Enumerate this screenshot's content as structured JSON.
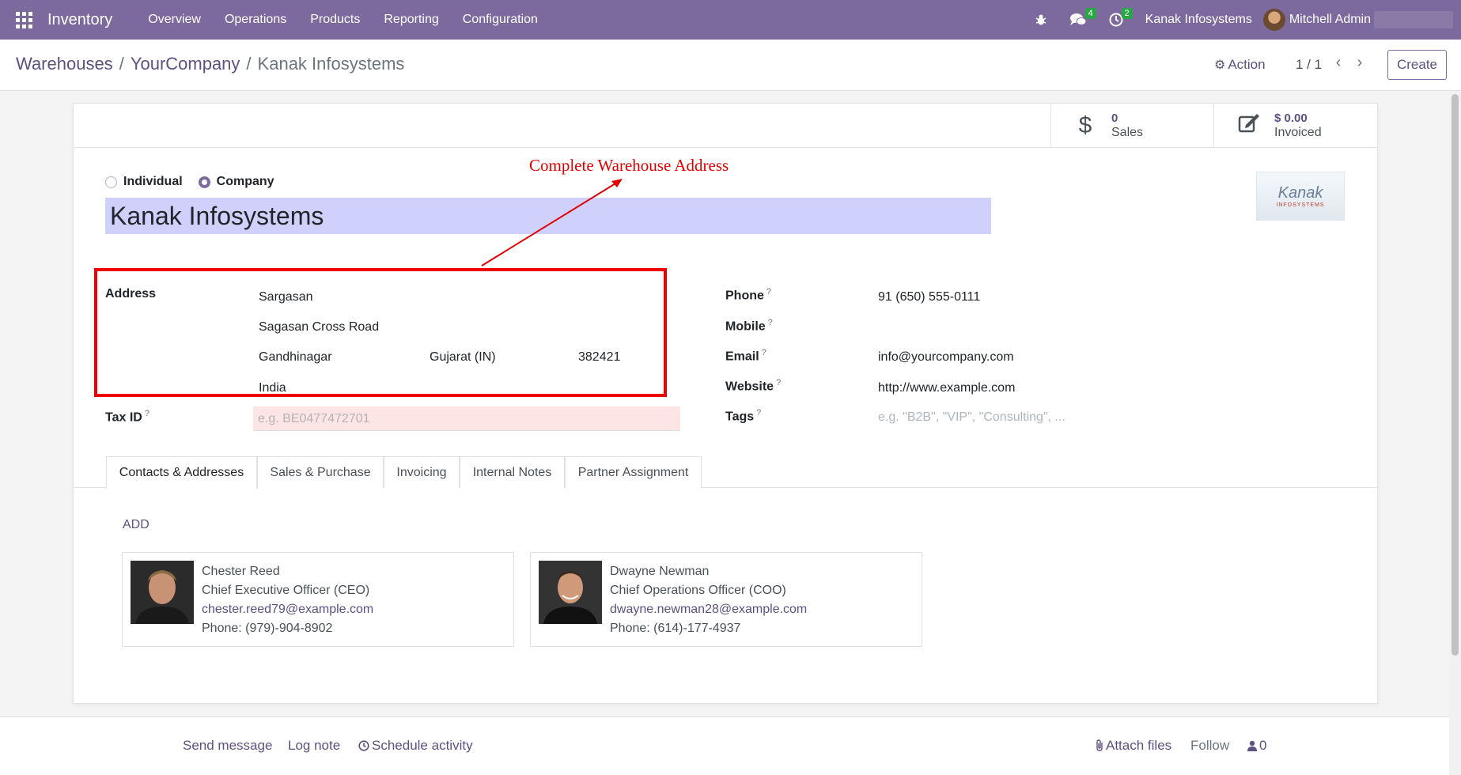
{
  "navbar": {
    "app_name": "Inventory",
    "menu": [
      "Overview",
      "Operations",
      "Products",
      "Reporting",
      "Configuration"
    ],
    "messages_badge": "4",
    "activities_badge": "2",
    "company": "Kanak Infosystems",
    "user": "Mitchell Admin",
    "accent_color": "#7c6a9e"
  },
  "breadcrumb": {
    "items": [
      "Warehouses",
      "YourCompany"
    ],
    "current": "Kanak Infosystems"
  },
  "control": {
    "action_label": "Action",
    "pager": "1 / 1",
    "create_label": "Create"
  },
  "stat_buttons": {
    "sales": {
      "value": "0",
      "label": "Sales",
      "icon": "dollar-icon"
    },
    "invoiced": {
      "value": "$ 0.00",
      "label": "Invoiced",
      "icon": "edit-icon"
    }
  },
  "company_type": {
    "individual": "Individual",
    "company": "Company",
    "selected": "company"
  },
  "partner_name": "Kanak Infosystems",
  "logo": {
    "text": "Kanak",
    "sub": "INFOSYSTEMS"
  },
  "annotation": "Complete Warehouse Address",
  "address": {
    "label": "Address",
    "street": "Sargasan",
    "street2": "Sagasan Cross Road",
    "city": "Gandhinagar",
    "state": "Gujarat (IN)",
    "zip": "382421",
    "country": "India"
  },
  "tax": {
    "label": "Tax ID",
    "placeholder": "e.g. BE0477472701"
  },
  "contact_fields": {
    "phone_label": "Phone",
    "phone": "91 (650) 555-0111",
    "mobile_label": "Mobile",
    "email_label": "Email",
    "email": "info@yourcompany.com",
    "website_label": "Website",
    "website": "http://www.example.com",
    "tags_label": "Tags",
    "tags_placeholder": "e.g. \"B2B\", \"VIP\", \"Consulting\", ..."
  },
  "help_mark": "?",
  "tabs": [
    "Contacts & Addresses",
    "Sales & Purchase",
    "Invoicing",
    "Internal Notes",
    "Partner Assignment"
  ],
  "add_label": "ADD",
  "contacts": [
    {
      "name": "Chester Reed",
      "title": "Chief Executive Officer (CEO)",
      "email": "chester.reed79@example.com",
      "phone": "Phone: (979)-904-8902"
    },
    {
      "name": "Dwayne Newman",
      "title": "Chief Operations Officer (COO)",
      "email": "dwayne.newman28@example.com",
      "phone": "Phone: (614)-177-4937"
    }
  ],
  "chatter": {
    "send_message": "Send message",
    "log_note": "Log note",
    "schedule_activity": "Schedule activity",
    "attach_files": "Attach files",
    "follow": "Follow",
    "followers": "0"
  }
}
